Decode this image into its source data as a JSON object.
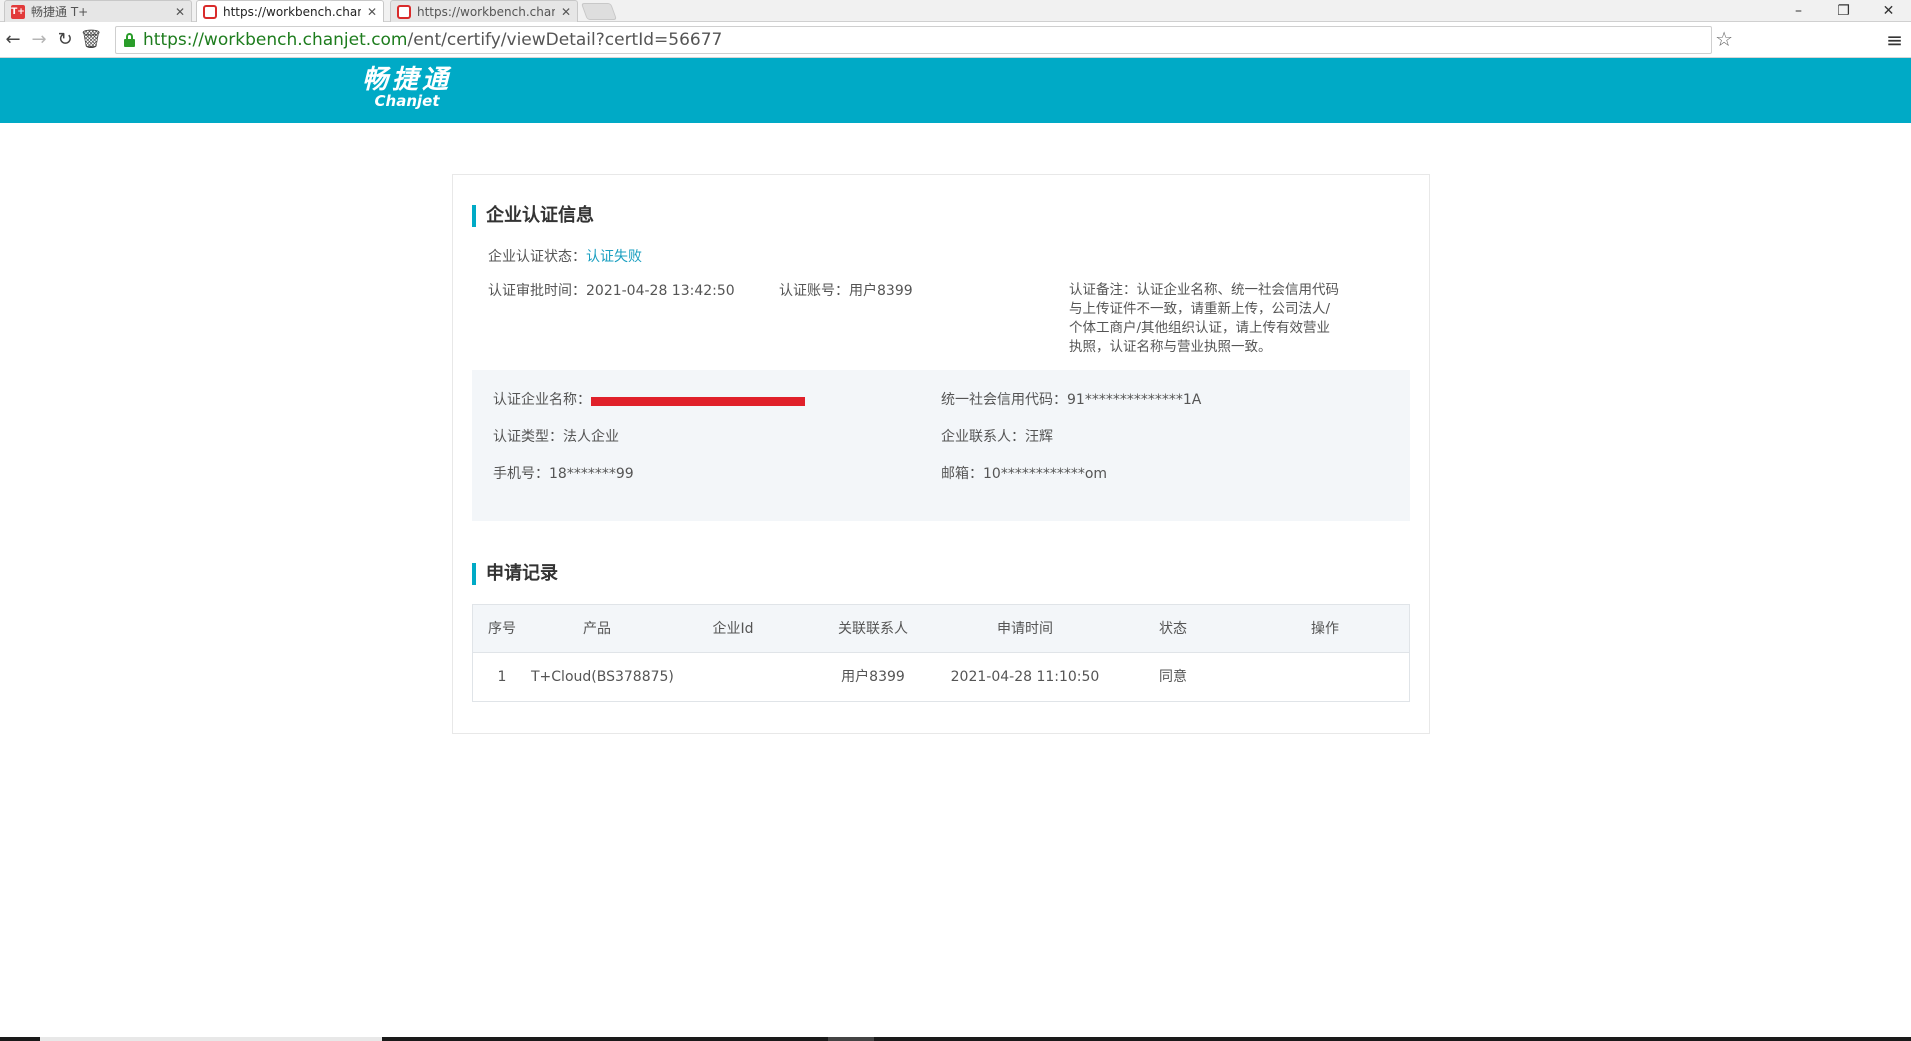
{
  "browser": {
    "tabs": [
      {
        "title": "畅捷通 T+",
        "active": false
      },
      {
        "title": "https://workbench.chan",
        "active": true
      },
      {
        "title": "https://workbench.chan",
        "active": false
      }
    ],
    "url_host": "https://workbench.chanjet.com",
    "url_path": "/ent/certify/viewDetail?certId=56677"
  },
  "header": {
    "logo_cn": "畅捷通",
    "logo_en": "Chanjet",
    "bg_color": "#00aac6"
  },
  "cert_info": {
    "section_title": "企业认证信息",
    "status_label": "企业认证状态：",
    "status_value": "认证失败",
    "review_time_label": "认证审批时间：",
    "review_time_value": "2021-04-28 13:42:50",
    "account_label": "认证账号：",
    "account_value": "用户8399",
    "remark_label": "认证备注：",
    "remark_value": "认证企业名称、统一社会信用代码与上传证件不一致，请重新上传，公司法人/个体工商户/其他组织认证，请上传有效营业执照，认证名称与营业执照一致。"
  },
  "details": {
    "company_name_label": "认证企业名称：",
    "credit_code_label": "统一社会信用代码：",
    "credit_code_value": "91**************1A",
    "type_label": "认证类型：",
    "type_value": "法人企业",
    "contact_label": "企业联系人：",
    "contact_value": "汪辉",
    "phone_label": "手机号：",
    "phone_value": "18*******99",
    "email_label": "邮箱：",
    "email_value": "10************om"
  },
  "records": {
    "section_title": "申请记录",
    "columns": [
      "序号",
      "产品",
      "企业Id",
      "关联联系人",
      "申请时间",
      "状态",
      "操作"
    ],
    "rows": [
      [
        "1",
        "T+Cloud(BS378875)",
        "",
        "用户8399",
        "2021-04-28 11:10:50",
        "同意",
        ""
      ]
    ]
  }
}
